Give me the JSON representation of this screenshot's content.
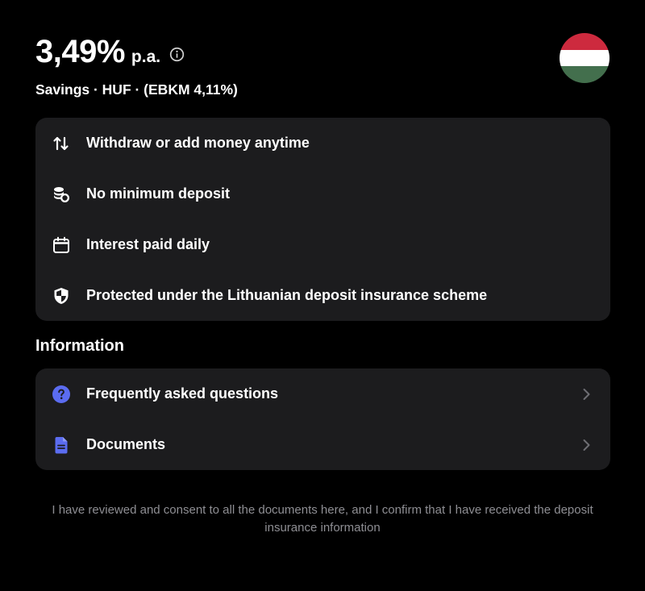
{
  "header": {
    "rate_value": "3,49%",
    "rate_unit": "p.a.",
    "subtitle": "Savings · HUF · (EBKM 4,11%)",
    "flag_colors": [
      "#CD2A3E",
      "#FFFFFF",
      "#436F4D"
    ]
  },
  "features": [
    {
      "icon": "arrows-up-down-icon",
      "label": "Withdraw or add money anytime"
    },
    {
      "icon": "coins-icon",
      "label": "No minimum deposit"
    },
    {
      "icon": "calendar-icon",
      "label": "Interest paid daily"
    },
    {
      "icon": "shield-icon",
      "label": "Protected under the Lithuanian deposit insurance scheme"
    }
  ],
  "information": {
    "title": "Information",
    "items": [
      {
        "icon": "question-circle-icon",
        "label": "Frequently asked questions"
      },
      {
        "icon": "document-icon",
        "label": "Documents"
      }
    ]
  },
  "footer_text": "I have reviewed and consent to all the documents here, and I confirm that I have received the deposit insurance information",
  "colors": {
    "background": "#000000",
    "card": "#1C1C1E",
    "accent": "#5B6CF0",
    "muted_text": "#8E8E93"
  }
}
